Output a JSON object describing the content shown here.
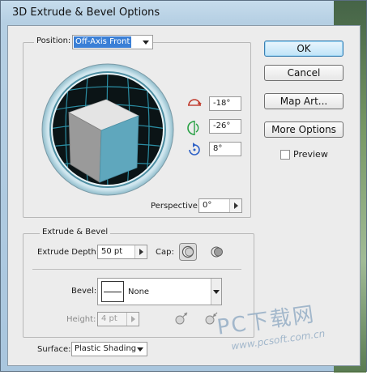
{
  "window": {
    "title": "3D Extrude & Bevel Options"
  },
  "position": {
    "label": "Position:",
    "selected": "Off-Axis Front",
    "rotation_x": "-18°",
    "rotation_y": "-26°",
    "rotation_z": "8°",
    "perspective_label": "Perspective:",
    "perspective_value": "0°"
  },
  "buttons": {
    "ok": "OK",
    "cancel": "Cancel",
    "map_art": "Map Art...",
    "more_options": "More Options"
  },
  "preview": {
    "label": "Preview",
    "checked": false
  },
  "extrude": {
    "section_label": "Extrude & Bevel",
    "depth_label": "Extrude Depth:",
    "depth_value": "50 pt",
    "cap_label": "Cap:"
  },
  "bevel": {
    "label": "Bevel:",
    "selected": "None",
    "height_label": "Height:",
    "height_value": "4 pt"
  },
  "surface": {
    "label": "Surface:",
    "selected": "Plastic Shading"
  },
  "icons": {
    "x_axis": "rotate-x-icon",
    "y_axis": "rotate-y-icon",
    "z_axis": "rotate-z-icon"
  },
  "colors": {
    "cube_front": "#5fa7bd",
    "cube_top": "#e4e4e4",
    "cube_side": "#9a9a9a",
    "track_ring": "#1a5160",
    "default_button": "#bfe3f8"
  },
  "watermark": {
    "main": "PC下载网",
    "url": "www.pcsoft.com.cn"
  }
}
